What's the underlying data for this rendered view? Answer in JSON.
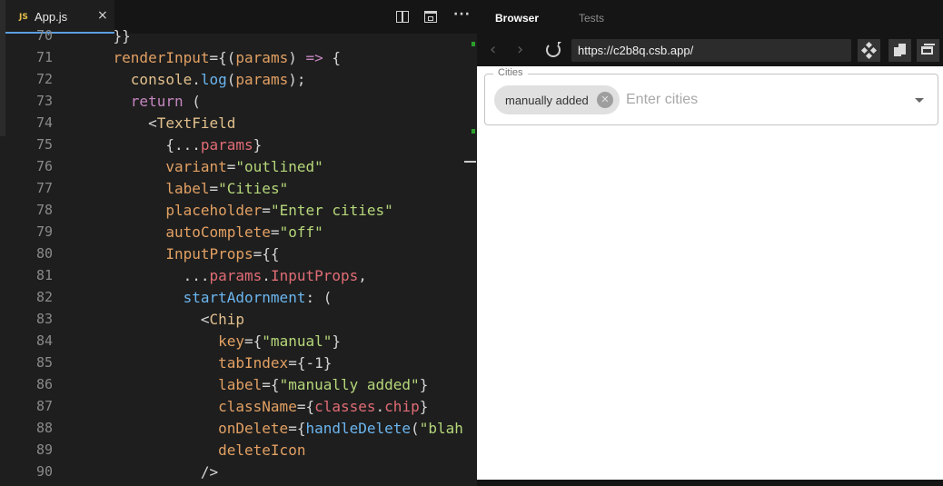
{
  "editor": {
    "tab": {
      "badge": "JS",
      "name": "App.js",
      "close": "×"
    },
    "toolbar": {
      "more": "···"
    },
    "lines": [
      {
        "n": "70",
        "segs": [
          [
            "    }}",
            "p"
          ]
        ]
      },
      {
        "n": "71",
        "segs": [
          [
            "    ",
            "p"
          ],
          [
            "renderInput",
            "at"
          ],
          [
            "={(",
            "p"
          ],
          [
            "params",
            "at"
          ],
          [
            ") ",
            "p"
          ],
          [
            "=>",
            "k"
          ],
          [
            " {",
            "p"
          ]
        ]
      },
      {
        "n": "72",
        "segs": [
          [
            "      ",
            "p"
          ],
          [
            "console",
            "fn"
          ],
          [
            ".",
            "p"
          ],
          [
            "log",
            "bl"
          ],
          [
            "(",
            "p"
          ],
          [
            "params",
            "at"
          ],
          [
            ");",
            "p"
          ]
        ]
      },
      {
        "n": "73",
        "segs": [
          [
            "      ",
            "p"
          ],
          [
            "return",
            "k"
          ],
          [
            " (",
            "p"
          ]
        ]
      },
      {
        "n": "74",
        "segs": [
          [
            "        <",
            "p"
          ],
          [
            "TextField",
            "tag"
          ]
        ]
      },
      {
        "n": "75",
        "segs": [
          [
            "          {...",
            "p"
          ],
          [
            "params",
            "pr"
          ],
          [
            "}",
            "p"
          ]
        ]
      },
      {
        "n": "76",
        "segs": [
          [
            "          ",
            "p"
          ],
          [
            "variant",
            "at"
          ],
          [
            "=",
            "p"
          ],
          [
            "\"outlined\"",
            "str"
          ]
        ]
      },
      {
        "n": "77",
        "segs": [
          [
            "          ",
            "p"
          ],
          [
            "label",
            "at"
          ],
          [
            "=",
            "p"
          ],
          [
            "\"Cities\"",
            "str"
          ]
        ]
      },
      {
        "n": "78",
        "segs": [
          [
            "          ",
            "p"
          ],
          [
            "placeholder",
            "at"
          ],
          [
            "=",
            "p"
          ],
          [
            "\"Enter cities\"",
            "str"
          ]
        ]
      },
      {
        "n": "79",
        "segs": [
          [
            "          ",
            "p"
          ],
          [
            "autoComplete",
            "at"
          ],
          [
            "=",
            "p"
          ],
          [
            "\"off\"",
            "str"
          ]
        ]
      },
      {
        "n": "80",
        "segs": [
          [
            "          ",
            "p"
          ],
          [
            "InputProps",
            "at"
          ],
          [
            "={{",
            "p"
          ]
        ]
      },
      {
        "n": "81",
        "segs": [
          [
            "            ...",
            "p"
          ],
          [
            "params",
            "pr"
          ],
          [
            ".",
            "p"
          ],
          [
            "InputProps",
            "pr"
          ],
          [
            ",",
            "p"
          ]
        ]
      },
      {
        "n": "82",
        "segs": [
          [
            "            ",
            "p"
          ],
          [
            "startAdornment",
            "bl"
          ],
          [
            ": (",
            "p"
          ]
        ]
      },
      {
        "n": "83",
        "segs": [
          [
            "              <",
            "p"
          ],
          [
            "Chip",
            "tag"
          ]
        ]
      },
      {
        "n": "84",
        "segs": [
          [
            "                ",
            "p"
          ],
          [
            "key",
            "at"
          ],
          [
            "={",
            "p"
          ],
          [
            "\"manual\"",
            "str"
          ],
          [
            "}",
            "p"
          ]
        ]
      },
      {
        "n": "85",
        "segs": [
          [
            "                ",
            "p"
          ],
          [
            "tabIndex",
            "at"
          ],
          [
            "={-1}",
            "p"
          ]
        ]
      },
      {
        "n": "86",
        "segs": [
          [
            "                ",
            "p"
          ],
          [
            "label",
            "at"
          ],
          [
            "={",
            "p"
          ],
          [
            "\"manually added\"",
            "str"
          ],
          [
            "}",
            "p"
          ]
        ]
      },
      {
        "n": "87",
        "segs": [
          [
            "                ",
            "p"
          ],
          [
            "className",
            "at"
          ],
          [
            "={",
            "p"
          ],
          [
            "classes",
            "pr"
          ],
          [
            ".",
            "p"
          ],
          [
            "chip",
            "pr"
          ],
          [
            "}",
            "p"
          ]
        ]
      },
      {
        "n": "88",
        "segs": [
          [
            "                ",
            "p"
          ],
          [
            "onDelete",
            "at"
          ],
          [
            "={",
            "p"
          ],
          [
            "handleDelete",
            "bl"
          ],
          [
            "(",
            "p"
          ],
          [
            "\"blah",
            "str"
          ]
        ]
      },
      {
        "n": "89",
        "segs": [
          [
            "                ",
            "p"
          ],
          [
            "deleteIcon",
            "at"
          ]
        ]
      },
      {
        "n": "90",
        "segs": [
          [
            "              />",
            "p"
          ]
        ]
      }
    ]
  },
  "browser": {
    "tabs": {
      "browser": "Browser",
      "tests": "Tests"
    },
    "nav": {
      "back": "‹",
      "forward": "›"
    },
    "url": "https://c2b8q.csb.app/",
    "app": {
      "field_label": "Cities",
      "chip_label": "manually added",
      "chip_delete": "✕",
      "input_placeholder": "Enter cities",
      "input_value": ""
    }
  },
  "colors": {
    "accent": "#5b9ee0",
    "editor_bg": "#1e1e1e",
    "panel_bg": "#151515"
  }
}
